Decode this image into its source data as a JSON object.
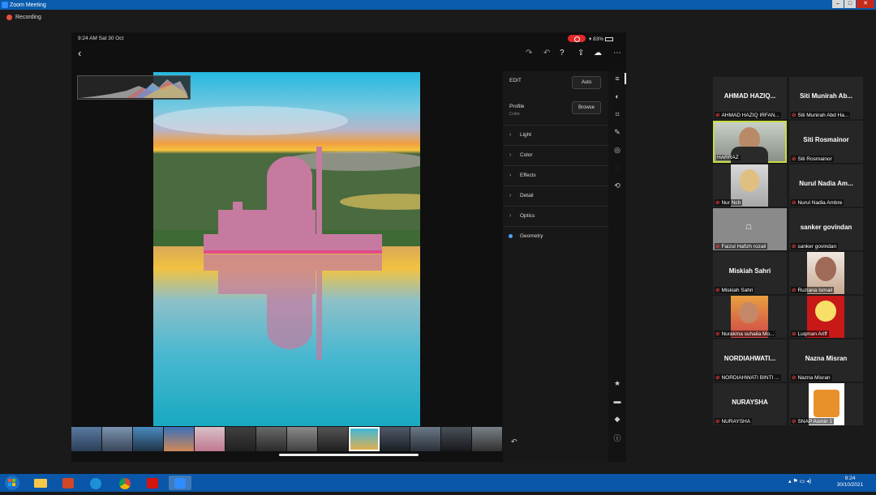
{
  "window": {
    "title": "Zoom Meeting",
    "recording_label": "Recording"
  },
  "shared_screen": {
    "status_time": "9:24 AM  Sat 30 Oct",
    "battery": "83%",
    "edit_panel": {
      "edit_label": "EDIT",
      "auto_button": "Auto",
      "profile_label": "Profile",
      "profile_value": "Color",
      "browse_button": "Browse",
      "sections": [
        "Light",
        "Color",
        "Effects",
        "Detail",
        "Optics",
        "Geometry"
      ],
      "active_section": "Geometry"
    }
  },
  "participants": [
    {
      "name": "AHMAD  HAZIQ...",
      "label": "AHMAD HAZIQ IRFAN...",
      "video": false
    },
    {
      "name": "Siti Munirah Ab...",
      "label": "Siti Munirah Abd Ha...",
      "video": false
    },
    {
      "name": "",
      "label": "HARRAZ",
      "video": true,
      "active_speaker": true
    },
    {
      "name": "Siti Rosmainor",
      "label": "Siti Rosmainor",
      "video": false
    },
    {
      "name": "",
      "label": "Nur Nch",
      "video": true
    },
    {
      "name": "Nurul Nadia Am...",
      "label": "Nurul Nadia Ambre",
      "video": false
    },
    {
      "name": "",
      "label": "Faizul Hafizh rozali",
      "video": false
    },
    {
      "name": "sanker govindan",
      "label": "sanker govindan",
      "video": false
    },
    {
      "name": "Miskiah Sahri",
      "label": "Miskiah Sahri",
      "video": false
    },
    {
      "name": "",
      "label": "Ruziana Ismail",
      "video": true
    },
    {
      "name": "",
      "label": "Nurakma suhaila Mo...",
      "video": true
    },
    {
      "name": "",
      "label": "Luqman Ariff",
      "video": true
    },
    {
      "name": "NORDIAHWATI...",
      "label": "NORDIAHWATI BINTI ...",
      "video": false
    },
    {
      "name": "Nazna Misran",
      "label": "Nazna Misran",
      "video": false
    },
    {
      "name": "NURAYSHA",
      "label": "NURAYSHA",
      "video": false
    },
    {
      "name": "",
      "label": "SNAP Asmin 1",
      "video": true
    }
  ],
  "taskbar": {
    "time": "9:24",
    "date": "30/10/2021"
  }
}
